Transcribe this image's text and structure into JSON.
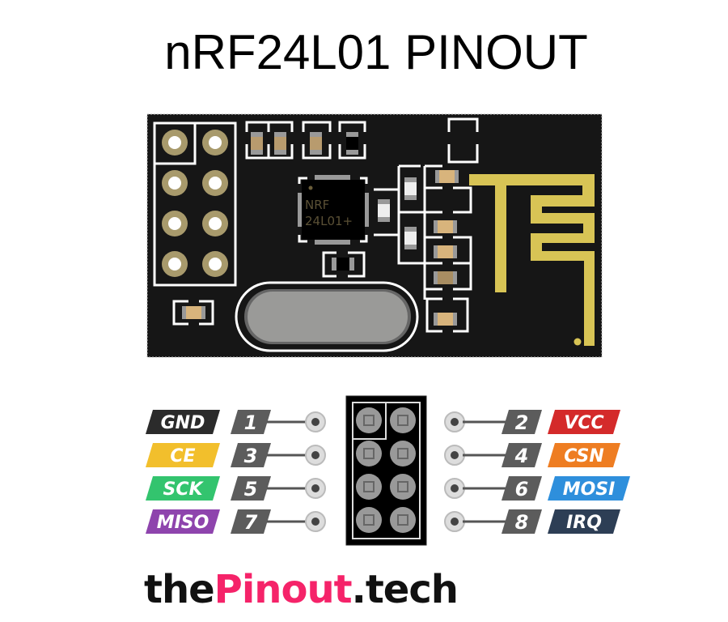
{
  "title": "nRF24L01 PINOUT",
  "chip_label": {
    "line1": "NRF",
    "line2": "24L01+"
  },
  "pins_left": [
    {
      "number": "1",
      "name": "GND",
      "color": "#2b2b2b"
    },
    {
      "number": "3",
      "name": "CE",
      "color": "#f2bf2c"
    },
    {
      "number": "5",
      "name": "SCK",
      "color": "#33c46e"
    },
    {
      "number": "7",
      "name": "MISO",
      "color": "#8e44ad"
    }
  ],
  "pins_right": [
    {
      "number": "2",
      "name": "VCC",
      "color": "#d42a2a"
    },
    {
      "number": "4",
      "name": "CSN",
      "color": "#ee7d22"
    },
    {
      "number": "6",
      "name": "MOSI",
      "color": "#2e8fdc"
    },
    {
      "number": "8",
      "name": "IRQ",
      "color": "#2d3e55"
    }
  ],
  "colors": {
    "pcb": "#161616",
    "silkscreen": "#ffffff",
    "pad_gold": "#a89a6c",
    "antenna": "#d8c455",
    "pin_number_bg": "#5c5c5c"
  },
  "footer": {
    "part1": "the",
    "part2": "Pinout",
    "part3": ".tech"
  }
}
